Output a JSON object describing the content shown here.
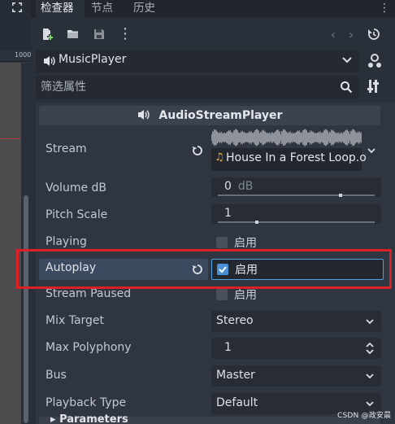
{
  "tabs": [
    {
      "label": "检查器",
      "active": true
    },
    {
      "label": "节点",
      "active": false
    },
    {
      "label": "历史",
      "active": false
    }
  ],
  "ruler_label": "1000",
  "toolbar": {
    "icons": [
      "new-resource-icon",
      "open-folder-icon",
      "save-icon",
      "more-options-icon",
      "history-back-icon",
      "history-forward-icon",
      "object-history-icon"
    ]
  },
  "node_selector": {
    "name": "MusicPlayer",
    "icon": "speaker-icon"
  },
  "filter": {
    "placeholder": "筛选属性"
  },
  "class_header": "AudioStreamPlayer",
  "properties": {
    "stream": {
      "label": "Stream",
      "file": "House In a Forest Loop.o"
    },
    "volume_db": {
      "label": "Volume dB",
      "value": "0",
      "suffix": "dB",
      "slider_fraction": 0.78
    },
    "pitch_scale": {
      "label": "Pitch Scale",
      "value": "1",
      "slider_fraction": 0.25
    },
    "playing": {
      "label": "Playing",
      "checked": false,
      "check_text": "启用"
    },
    "autoplay": {
      "label": "Autoplay",
      "checked": true,
      "check_text": "启用"
    },
    "stream_paused": {
      "label": "Stream Paused",
      "checked": false,
      "check_text": "启用"
    },
    "mix_target": {
      "label": "Mix Target",
      "value": "Stereo"
    },
    "max_polyphony": {
      "label": "Max Polyphony",
      "value": "1"
    },
    "bus": {
      "label": "Bus",
      "value": "Master"
    },
    "playback_type": {
      "label": "Playback Type",
      "value": "Default"
    }
  },
  "next_section": "Parameters",
  "watermark": "CSDN @政安晨",
  "colors": {
    "accent": "#4fa2df",
    "highlight_frame": "#dd1f26",
    "panel_bg": "#2f3642"
  }
}
